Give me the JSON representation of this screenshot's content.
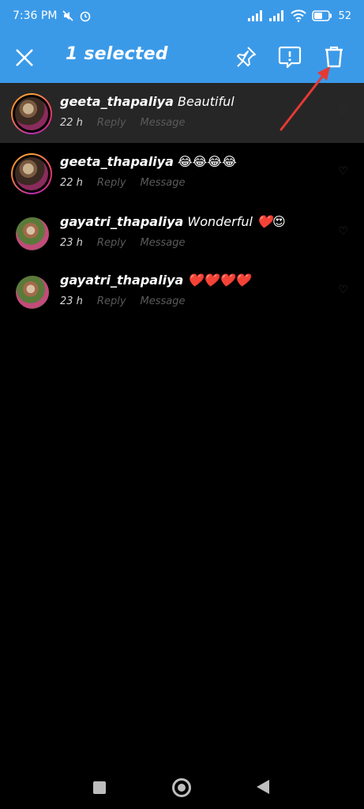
{
  "status": {
    "time": "7:36 PM",
    "battery": "52"
  },
  "header": {
    "title": "1 selected"
  },
  "comments": [
    {
      "user": "geeta_thapaliya",
      "text": "Beautiful",
      "time": "22 h",
      "reply": "Reply",
      "message": "Message"
    },
    {
      "user": "geeta_thapaliya",
      "text": "😂😂😂😂",
      "time": "22 h",
      "reply": "Reply",
      "message": "Message"
    },
    {
      "user": "gayatri_thapaliya",
      "text": "Wonderful ❤️😍",
      "time": "23 h",
      "reply": "Reply",
      "message": "Message"
    },
    {
      "user": "gayatri_thapaliya",
      "text": "❤️❤️❤️❤️",
      "time": "23 h",
      "reply": "Reply",
      "message": "Message"
    }
  ],
  "colors": {
    "accent": "#3b9ae8",
    "selected_row": "#262626",
    "annotation_arrow": "#e53935"
  },
  "icons": [
    "close-icon",
    "pin-icon",
    "report-icon",
    "trash-icon"
  ]
}
